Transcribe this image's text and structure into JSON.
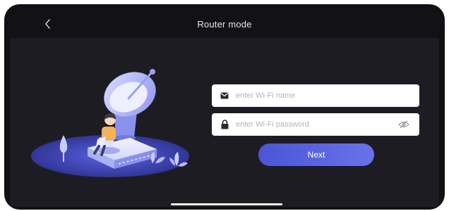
{
  "header": {
    "title": "Router mode",
    "back_icon": "chevron-left-icon"
  },
  "form": {
    "wifi_name": {
      "placeholder": "enter Wi-Fi name",
      "value": "",
      "icon": "envelope-icon"
    },
    "wifi_password": {
      "placeholder": "enter Wi-Fi password",
      "value": "",
      "icon": "lock-icon",
      "toggle_icon": "eye-off-icon"
    },
    "next_label": "Next"
  },
  "colors": {
    "background": "#1d1c22",
    "topbar": "#121216",
    "accent": "#5a63e0",
    "field_background": "#ffffff"
  }
}
